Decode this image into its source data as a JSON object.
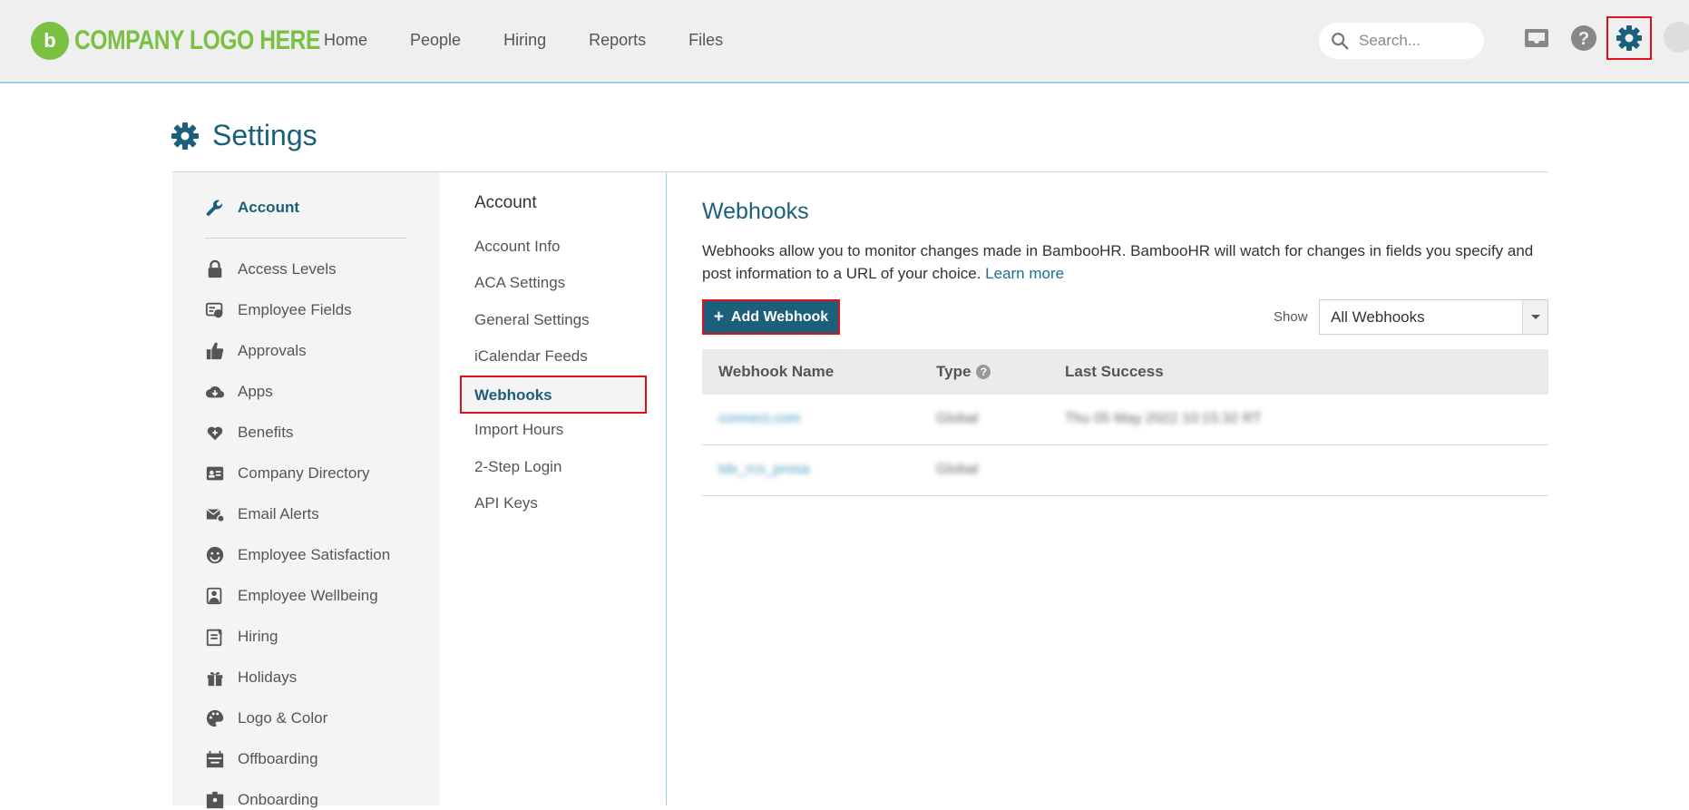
{
  "header": {
    "logo_mark": "b",
    "logo_text": "COMPANY LOGO HERE",
    "nav": [
      "Home",
      "People",
      "Hiring",
      "Reports",
      "Files"
    ],
    "search_placeholder": "Search..."
  },
  "page": {
    "title": "Settings"
  },
  "sidebar": {
    "active": "Account",
    "items": [
      {
        "label": "Access Levels",
        "icon": "lock-icon"
      },
      {
        "label": "Employee Fields",
        "icon": "id-card-icon"
      },
      {
        "label": "Approvals",
        "icon": "thumbs-up-icon"
      },
      {
        "label": "Apps",
        "icon": "cloud-download-icon"
      },
      {
        "label": "Benefits",
        "icon": "heart-plus-icon"
      },
      {
        "label": "Company Directory",
        "icon": "address-card-icon"
      },
      {
        "label": "Email Alerts",
        "icon": "mail-alert-icon"
      },
      {
        "label": "Employee Satisfaction",
        "icon": "smile-icon"
      },
      {
        "label": "Employee Wellbeing",
        "icon": "wellbeing-icon"
      },
      {
        "label": "Hiring",
        "icon": "clipboard-icon"
      },
      {
        "label": "Holidays",
        "icon": "gift-icon"
      },
      {
        "label": "Logo & Color",
        "icon": "palette-icon"
      },
      {
        "label": "Offboarding",
        "icon": "calendar-exit-icon"
      },
      {
        "label": "Onboarding",
        "icon": "badge-icon"
      }
    ]
  },
  "subnav": {
    "heading": "Account",
    "items": [
      "Account Info",
      "ACA Settings",
      "General Settings",
      "iCalendar Feeds",
      "Webhooks",
      "Import Hours",
      "2-Step Login",
      "API Keys"
    ],
    "active": "Webhooks"
  },
  "main": {
    "title": "Webhooks",
    "description": "Webhooks allow you to monitor changes made in BambooHR. BambooHR will watch for changes in fields you specify and post information to a URL of your choice.",
    "learn_more": "Learn more",
    "add_button": "Add Webhook",
    "show_label": "Show",
    "show_value": "All Webhooks",
    "columns": [
      "Webhook Name",
      "Type",
      "Last Success"
    ],
    "rows": [
      {
        "name": "connect.com",
        "type": "Global",
        "last_success": "Thu 05 May 2022 10:15:32 RT"
      },
      {
        "name": "tdx_rcs_prosa",
        "type": "Global",
        "last_success": ""
      }
    ]
  },
  "colors": {
    "brand": "#7ac143",
    "accent": "#1b5f7a",
    "highlight": "#e0101a"
  }
}
